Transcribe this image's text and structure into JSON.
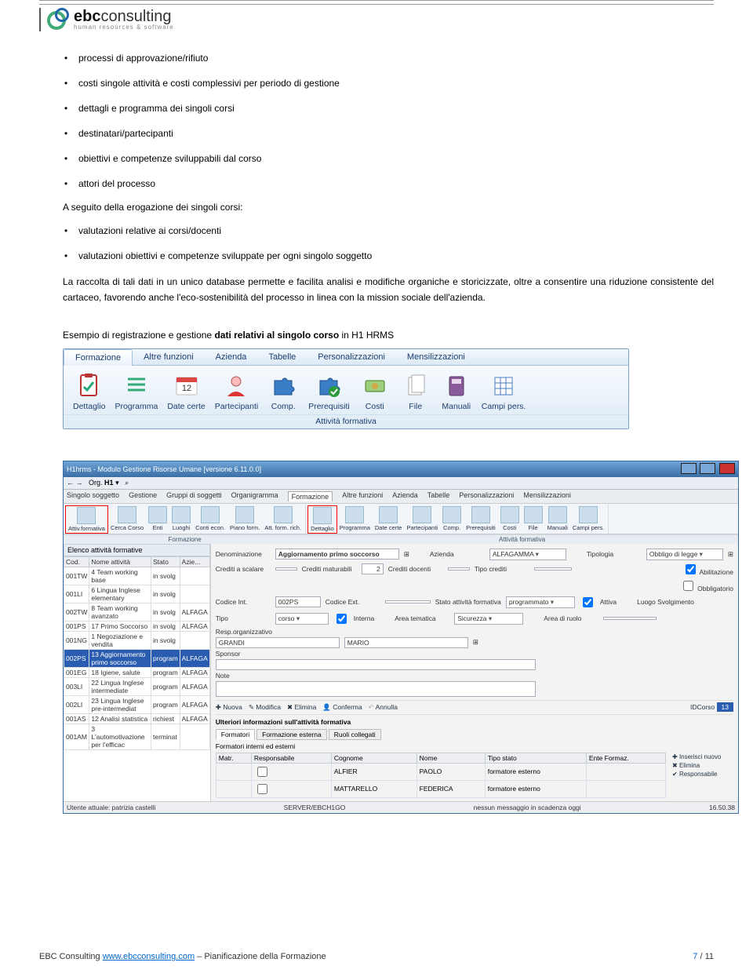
{
  "logo": {
    "brand_bold": "ebc",
    "brand_rest": "consulting",
    "tagline": "human resources & software"
  },
  "bullets1": [
    "processi di approvazione/rifiuto",
    "costi singole attività e costi complessivi per periodo di gestione",
    "dettagli e programma dei singoli corsi",
    "destinatari/partecipanti",
    "obiettivi e competenze sviluppabili dal corso",
    "attori del processo"
  ],
  "intro2": "A seguito della erogazione dei singoli corsi:",
  "bullets2": [
    "valutazioni relative ai corsi/docenti",
    "valutazioni obiettivi e competenze sviluppate per ogni singolo soggetto"
  ],
  "para": "La raccolta di tali dati in un unico database permette e facilita analisi e modifiche organiche e storicizzate, oltre a consentire una riduzione consistente del cartaceo, favorendo anche l'eco-sostenibilità del processo in linea con la mission sociale dell'azienda.",
  "caption_prefix": "Esempio di registrazione e gestione ",
  "caption_bold": "dati relativi al singolo corso",
  "caption_suffix": " in H1 HRMS",
  "ribbon": {
    "tabs": [
      "Formazione",
      "Altre funzioni",
      "Azienda",
      "Tabelle",
      "Personalizzazioni",
      "Mensilizzazioni"
    ],
    "items": [
      "Dettaglio",
      "Programma",
      "Date certe",
      "Partecipanti",
      "Comp.",
      "Prerequisiti",
      "Costi",
      "File",
      "Manuali",
      "Campi pers."
    ],
    "group_caption": "Attività formativa"
  },
  "app": {
    "title": "H1hrms - Modulo Gestione Risorse Umane [versione 6.11.0.0]",
    "toolbar_org_label": "Org.",
    "toolbar_org_value": "H1",
    "menu": [
      "Singolo soggetto",
      "Gestione",
      "Gruppi di soggetti",
      "Organigramma",
      "Formazione",
      "Altre funzioni",
      "Azienda",
      "Tabelle",
      "Personalizzazioni",
      "Mensilizzazioni"
    ],
    "menu_active": "Formazione",
    "ribbon2_group1": {
      "items": [
        "Attiv.formativa",
        "Cerca Corso",
        "Enti",
        "Luoghi",
        "Conti econ.",
        "Piano form.",
        "Att. form. rich."
      ],
      "caption": "Formazione",
      "active": "Attiv.formativa"
    },
    "ribbon2_group2": {
      "items": [
        "Dettaglio",
        "Programma",
        "Date certe",
        "Partecipanti",
        "Comp.",
        "Prerequisiti",
        "Costi",
        "File",
        "Manuali",
        "Campi pers."
      ],
      "caption": "Attività formativa",
      "active": "Dettaglio"
    },
    "left": {
      "title": "Elenco attività formative",
      "cols": [
        "Cod.",
        "Nome attività",
        "Stato",
        "Azie..."
      ],
      "rows": [
        [
          "001TW",
          "4 Team working base",
          "in svolg",
          ""
        ],
        [
          "001LI",
          "6 Lingua Inglese elementary",
          "in svolg",
          ""
        ],
        [
          "002TW",
          "8 Team working avanzato",
          "in svolg",
          "ALFAGA"
        ],
        [
          "001PS",
          "17 Primo Soccorso",
          "in svolg",
          "ALFAGA"
        ],
        [
          "001NG",
          "1 Negoziazione e vendita",
          "in svolg",
          ""
        ],
        [
          "002PS",
          "13 Aggiornamento primo soccorso",
          "program",
          "ALFAGA"
        ],
        [
          "001EG",
          "18 Igiene, salute",
          "program",
          "ALFAGA"
        ],
        [
          "003LI",
          "22 Lingua Inglese intermediate",
          "program",
          "ALFAGA"
        ],
        [
          "002LI",
          "23 Lingua Inglese pre-intermediat",
          "program",
          "ALFAGA"
        ],
        [
          "001AS",
          "12 Analisi statistica",
          "richiest",
          "ALFAGA"
        ],
        [
          "001AM",
          "3 L'automotivazione per l'efficac",
          "terminat",
          ""
        ]
      ],
      "selected_index": 5
    },
    "form": {
      "denominazione_lbl": "Denominazione",
      "denominazione": "Aggiornamento primo soccorso",
      "azienda_lbl": "Azienda",
      "azienda": "ALFAGAMMA",
      "tipologia_lbl": "Tipologia",
      "tipologia": "Obbligo di legge",
      "crediti_scalare_lbl": "Crediti a scalare",
      "crediti_maturabili_lbl": "Crediti maturabili",
      "crediti_maturabili": "2",
      "crediti_docenti_lbl": "Crediti docenti",
      "tipo_crediti_lbl": "Tipo crediti",
      "chk_abilitazione": "Abilitazione",
      "chk_obbligatorio": "Obbligatorio",
      "codice_int_lbl": "Codice Int.",
      "codice_int": "002PS",
      "codice_ext_lbl": "Codice Ext.",
      "stato_lbl": "Stato attività formativa",
      "stato": "programmato",
      "attiva_lbl": "Attiva",
      "luogo_lbl": "Luogo Svolgimento",
      "tipo_lbl": "Tipo",
      "tipo": "corso",
      "interna_lbl": "Interna",
      "area_tematica_lbl": "Area tematica",
      "area_tematica": "Sicurezza",
      "area_ruolo_lbl": "Area di ruolo",
      "resp_lbl": "Resp.organizzativo",
      "resp_cognome": "GRANDI",
      "resp_nome": "MARIO",
      "sponsor_lbl": "Sponsor",
      "note_lbl": "Note",
      "btns": [
        "Nuova",
        "Modifica",
        "Elimina",
        "Conferma",
        "Annulla"
      ],
      "idcorso_lbl": "IDCorso",
      "idcorso": "13",
      "info_title": "Ulteriori informazioni sull'attività formativa",
      "subtabs": [
        "Formatori",
        "Formazione esterna",
        "Ruoli collegati"
      ],
      "subgrid_title": "Formatori interni ed esterni",
      "subcols": [
        "Matr.",
        "Responsabile",
        "Cognome",
        "Nome",
        "Tipo stato",
        "Ente Formaz."
      ],
      "subrows": [
        [
          "",
          "",
          "ALFIER",
          "PAOLO",
          "formatore esterno",
          ""
        ],
        [
          "",
          "",
          "MATTARELLO",
          "FEDERICA",
          "formatore esterno",
          ""
        ]
      ],
      "side_btns": [
        "Inserisci nuovo",
        "Elimina",
        "Responsabile"
      ]
    },
    "status": {
      "user_lbl": "Utente attuale:",
      "user": "patrizia castelli",
      "server": "SERVER/EBCH1GO",
      "msg": "nessun messaggio in scadenza oggi",
      "time": "16.50.38"
    }
  },
  "footer": {
    "company": "EBC Consulting ",
    "url": "www.ebcconsulting.com",
    "tail": " – Pianificazione della Formazione",
    "page_cur": "7",
    "page_sep": " / ",
    "page_tot": "11"
  }
}
